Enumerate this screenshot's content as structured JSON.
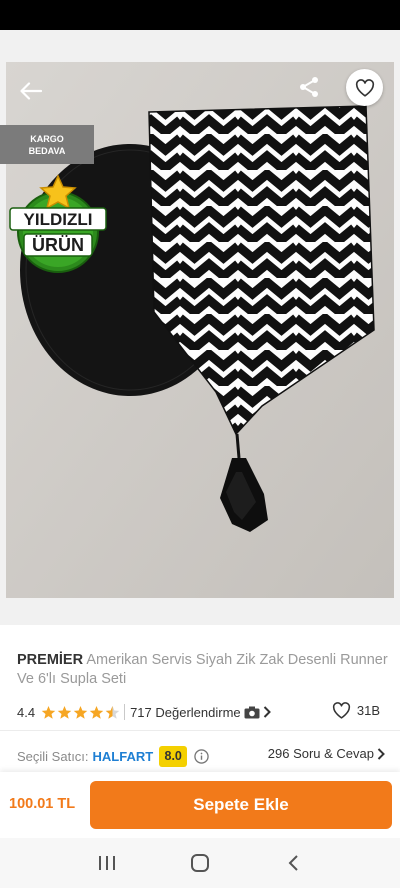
{
  "badges": {
    "cargo_line1": "KARGO",
    "cargo_line2": "BEDAVA",
    "star_line1": "YILDIZLI",
    "star_line2": "ÜRÜN"
  },
  "gallery": {
    "image_count": 5,
    "active_index": 0
  },
  "product": {
    "brand": "PREMİER",
    "name": "Amerikan Servis Siyah Zik Zak Desenli Runner Ve 6'lı Supla Seti"
  },
  "rating": {
    "score": "4.4",
    "stars": 4.4,
    "reviews": "717 Değerlendirme",
    "likes": "31B"
  },
  "seller": {
    "label": "Seçili Satıcı:",
    "name": "HALFART",
    "score": "8.0",
    "qa": "296 Soru & Cevap"
  },
  "cart": {
    "price": "100.01 TL",
    "button": "Sepete Ekle"
  },
  "colors": {
    "accent": "#f27a1a",
    "seller_link": "#1e7fd3",
    "score_badge": "#f4d000",
    "star": "#f6a623"
  },
  "icons": [
    "arrow-left-icon",
    "share-icon",
    "heart-icon",
    "camera-icon",
    "chevron-right-icon",
    "info-icon",
    "menu-icon",
    "home-icon",
    "back-icon"
  ]
}
